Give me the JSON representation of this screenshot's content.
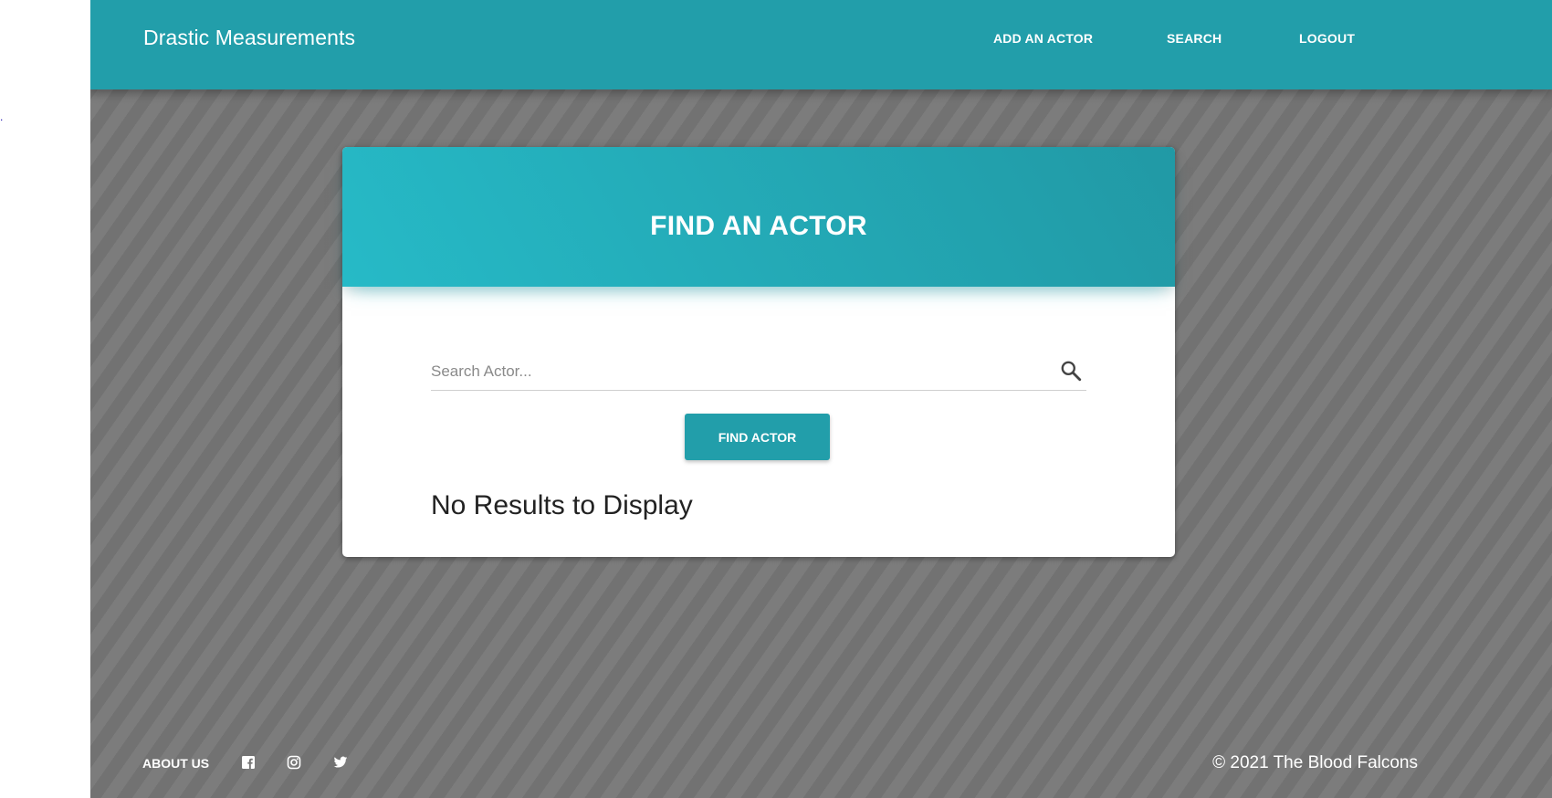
{
  "navbar": {
    "brand": "Drastic Measurements",
    "links": [
      "ADD AN ACTOR",
      "SEARCH",
      "LOGOUT"
    ]
  },
  "card": {
    "title": "FIND AN ACTOR",
    "search_placeholder": "Search Actor...",
    "search_value": "",
    "button_label": "FIND ACTOR",
    "no_results": "No Results to Display"
  },
  "footer": {
    "about_label": "ABOUT US",
    "social_icons": [
      "facebook-icon",
      "instagram-icon",
      "twitter-icon"
    ],
    "copyright": "© 2021 The Blood Falcons"
  },
  "colors": {
    "primary": "#229eaa",
    "header_gradient_start": "#26bac7",
    "header_gradient_end": "#2199a5",
    "background": "#767676"
  },
  "icons": {
    "search": "search-icon"
  }
}
